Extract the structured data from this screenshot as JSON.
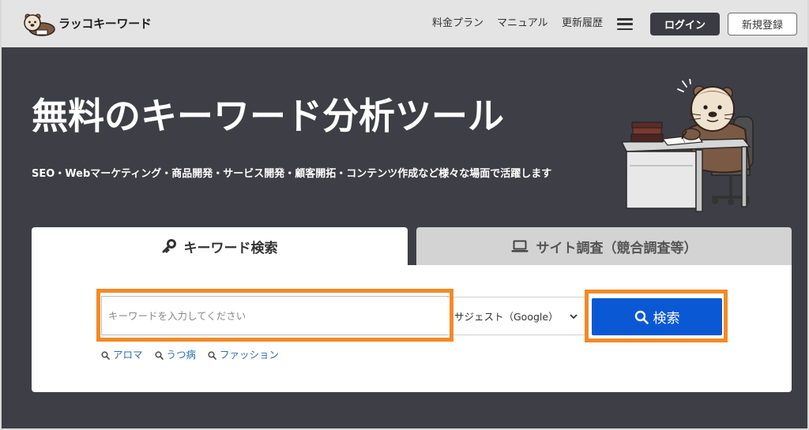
{
  "header": {
    "logo_text": "ラッコキーワード",
    "logo_icon": "otter-logo-icon",
    "nav": [
      "料金プラン",
      "マニュアル",
      "更新履歴"
    ],
    "menu_icon": "hamburger-menu-icon",
    "login_label": "ログイン",
    "signup_label": "新規登録"
  },
  "hero": {
    "title": "無料のキーワード分析ツール",
    "subtitle": "SEO・Webマーケティング・商品開発・サービス開発・顧客開拓・コンテンツ作成など様々な場面で活躍します"
  },
  "search": {
    "tabs": [
      {
        "label": "キーワード検索",
        "icon": "key-icon",
        "active": true
      },
      {
        "label": "サイト調査（競合調査等）",
        "icon": "laptop-icon",
        "active": false
      }
    ],
    "input": {
      "placeholder": "キーワードを入力してください"
    },
    "source_select": {
      "selected": "サジェスト（Google）",
      "icon": "chevron-down-icon"
    },
    "submit": {
      "label": "検索",
      "icon": "search-icon"
    },
    "suggestions": [
      {
        "label": "アロマ",
        "icon": "search-icon"
      },
      {
        "label": "うつ病",
        "icon": "search-icon"
      },
      {
        "label": "ファッション",
        "icon": "search-icon"
      }
    ]
  },
  "colors": {
    "header_bg": "#e4e4e4",
    "hero_bg": "#3e3e46",
    "primary": "#0b58d5",
    "highlight": "#f28a26",
    "link": "#2a6db5",
    "dark_button": "#3b3b43",
    "tab_inactive": "#d3d3d3"
  }
}
